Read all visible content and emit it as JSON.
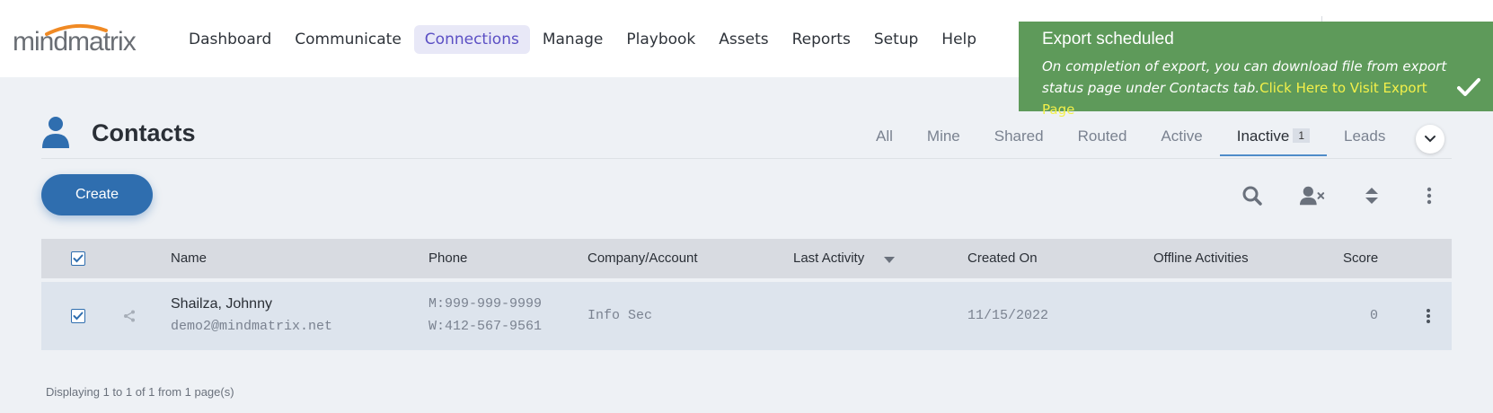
{
  "brand": {
    "logo_text": "mindmatrix",
    "accent": "#f08a24"
  },
  "nav": {
    "items": [
      {
        "label": "Dashboard"
      },
      {
        "label": "Communicate"
      },
      {
        "label": "Connections",
        "active": true
      },
      {
        "label": "Manage"
      },
      {
        "label": "Playbook"
      },
      {
        "label": "Assets"
      },
      {
        "label": "Reports"
      },
      {
        "label": "Setup"
      },
      {
        "label": "Help"
      }
    ]
  },
  "toast": {
    "title": "Export scheduled",
    "message": "On completion of export, you can download file from export status page under Contacts tab.",
    "link": "Click Here to Visit Export Page",
    "bg": "#5e9a5a"
  },
  "page": {
    "title": "Contacts",
    "icon": "user-icon"
  },
  "tabs": {
    "items": [
      {
        "label": "All"
      },
      {
        "label": "Mine"
      },
      {
        "label": "Shared"
      },
      {
        "label": "Routed"
      },
      {
        "label": "Active"
      },
      {
        "label": "Inactive",
        "count": "1",
        "active": true
      },
      {
        "label": "Leads"
      }
    ]
  },
  "toolbar": {
    "create_label": "Create",
    "icons": [
      "search-icon",
      "remove-user-icon",
      "sort-icon",
      "more-vertical-icon"
    ]
  },
  "table": {
    "columns": [
      "Name",
      "Phone",
      "Company/Account",
      "Last Activity",
      "Created On",
      "Offline Activities",
      "Score"
    ],
    "sorted_column": "Last Activity",
    "rows": [
      {
        "checked": true,
        "name": "Shailza, Johnny",
        "email": "demo2@mindmatrix.net",
        "phone_mobile": "M:999-999-9999",
        "phone_work": "W:412-567-9561",
        "company": "Info Sec",
        "last_activity": "",
        "created_on": "11/15/2022",
        "offline_activities": "",
        "score": "0"
      }
    ]
  },
  "footer": {
    "pagination": "Displaying 1 to 1 of 1 from 1 page(s)"
  }
}
